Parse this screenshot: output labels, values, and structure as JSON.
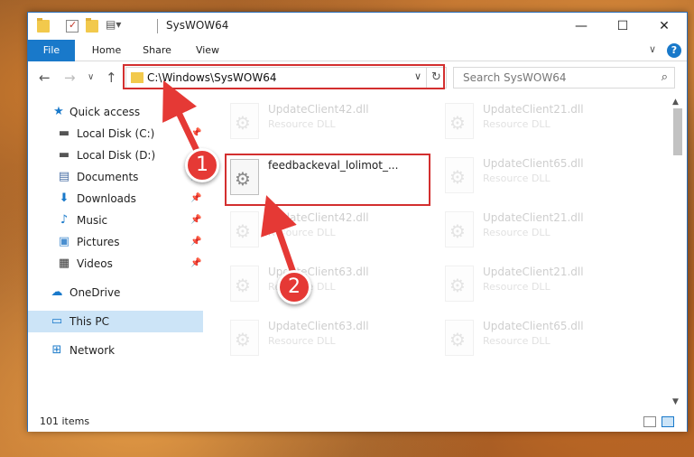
{
  "window": {
    "title": "SysWOW64",
    "minimize_glyph": "—",
    "maximize_glyph": "☐",
    "close_glyph": "✕"
  },
  "ribbon": {
    "tabs": [
      "File",
      "Home",
      "Share",
      "View"
    ],
    "collapse_glyph": "∨",
    "help_glyph": "?"
  },
  "navbar": {
    "back_glyph": "←",
    "forward_glyph": "→",
    "recent_glyph": "∨",
    "up_glyph": "↑",
    "address": "C:\\Windows\\SysWOW64",
    "address_chevron": "∨",
    "refresh_glyph": "↻",
    "search_placeholder": "Search SysWOW64",
    "search_glyph": "⌕"
  },
  "sidebar": {
    "items": [
      {
        "label": "Quick access",
        "icon": "star-icon",
        "glyph": "★",
        "color": "#1979ca"
      },
      {
        "label": "Local Disk (C:)",
        "icon": "drive-icon",
        "glyph": "▬",
        "color": "#555555",
        "pinned": true
      },
      {
        "label": "Local Disk (D:)",
        "icon": "drive-icon",
        "glyph": "▬",
        "color": "#555555",
        "pinned": true
      },
      {
        "label": "Documents",
        "icon": "documents-icon",
        "glyph": "▤",
        "color": "#4a6fa5",
        "pinned": true
      },
      {
        "label": "Downloads",
        "icon": "download-icon",
        "glyph": "⬇",
        "color": "#1979ca",
        "pinned": true
      },
      {
        "label": "Music",
        "icon": "music-icon",
        "glyph": "♪",
        "color": "#1979ca",
        "pinned": true
      },
      {
        "label": "Pictures",
        "icon": "pictures-icon",
        "glyph": "▣",
        "color": "#4a8fd0",
        "pinned": true
      },
      {
        "label": "Videos",
        "icon": "videos-icon",
        "glyph": "▦",
        "color": "#333333",
        "pinned": true
      },
      {
        "label": "OneDrive",
        "icon": "cloud-icon",
        "glyph": "☁",
        "color": "#1979ca"
      },
      {
        "label": "This PC",
        "icon": "computer-icon",
        "glyph": "▭",
        "color": "#1979ca",
        "selected": true
      },
      {
        "label": "Network",
        "icon": "network-icon",
        "glyph": "⊞",
        "color": "#1979ca"
      }
    ],
    "pin_glyph": "📌"
  },
  "files": [
    {
      "name": "UpdateClient42.dll",
      "type": "Resource DLL"
    },
    {
      "name": "UpdateClient21.dll",
      "type": "Resource DLL"
    },
    {
      "name": "feedbackeval_lolimot_...",
      "type": ""
    },
    {
      "name": "UpdateClient65.dll",
      "type": "Resource DLL"
    },
    {
      "name": "UpdateClient42.dll",
      "type": "Resource DLL"
    },
    {
      "name": "UpdateClient21.dll",
      "type": "Resource DLL"
    },
    {
      "name": "UpdateClient63.dll",
      "type": "Resource DLL"
    },
    {
      "name": "UpdateClient21.dll",
      "type": "Resource DLL"
    },
    {
      "name": "UpdateClient63.dll",
      "type": "Resource DLL"
    },
    {
      "name": "UpdateClient65.dll",
      "type": "Resource DLL"
    }
  ],
  "status": {
    "item_count": "101 items"
  },
  "annotations": {
    "step1": "1",
    "step2": "2",
    "color": "#e53935"
  }
}
